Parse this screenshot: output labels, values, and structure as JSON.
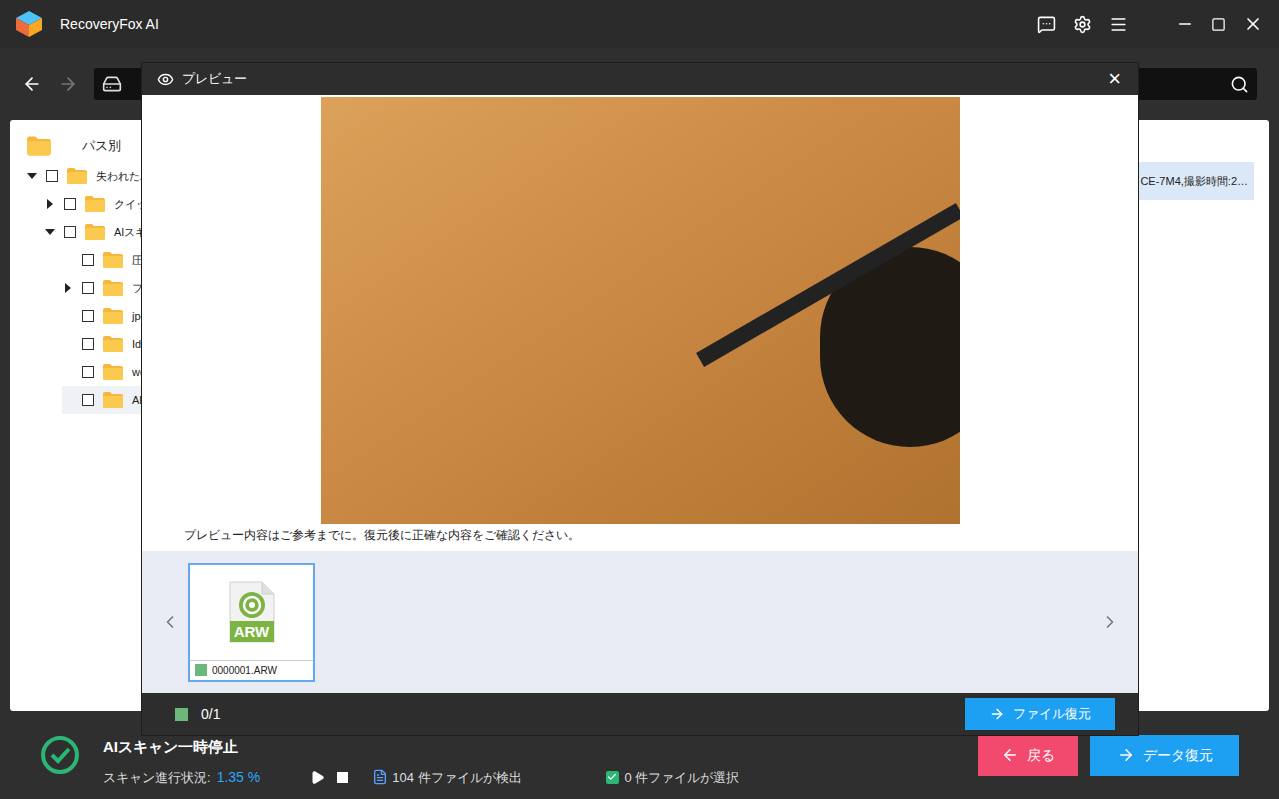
{
  "window": {
    "title": "RecoveryFox AI"
  },
  "tree": {
    "header": "パス別",
    "items": [
      {
        "label": "失われたパ",
        "checked": false,
        "expanded": true,
        "selected": false,
        "children": [
          {
            "label": "クイックス",
            "checked": false,
            "expanded": false,
            "selected": false,
            "children": []
          },
          {
            "label": "AIスキャ",
            "checked": false,
            "expanded": true,
            "selected": false,
            "children": [
              {
                "label": "圧縮",
                "checked": false,
                "selected": false
              },
              {
                "label": "ファ",
                "checked": false,
                "expanded": false,
                "selected": false,
                "children": []
              },
              {
                "label": "jpg",
                "checked": false,
                "selected": false
              },
              {
                "label": "Ider",
                "checked": false,
                "selected": false
              },
              {
                "label": "web",
                "checked": false,
                "selected": false
              },
              {
                "label": "ARW",
                "checked": false,
                "selected": true
              }
            ]
          }
        ]
      }
    ]
  },
  "file_rows": [
    {
      "text": "CE-7M4,撮影時間:2…",
      "selected": true
    }
  ],
  "dialog": {
    "title": "プレビュー",
    "close": "×",
    "note": "プレビュー内容はご参考までに。復元後に正確な内容をご確認ください。",
    "thumbnails": [
      {
        "name": "0000001.ARW",
        "ext": "ARW",
        "selected": true,
        "color": "#6bb87a"
      }
    ],
    "counter": "0/1",
    "button": "ファイル復元"
  },
  "status_bar": {
    "title": "AIスキャン一時停止",
    "progress_label": "スキャン進行状況:",
    "progress": "1.35 %",
    "found": "104 件ファイルが検出",
    "selected_count": "0 件ファイルが選択",
    "buttons": [
      {
        "label": "戻る",
        "kind": "back"
      },
      {
        "label": "データ復元",
        "kind": "recover"
      }
    ]
  }
}
